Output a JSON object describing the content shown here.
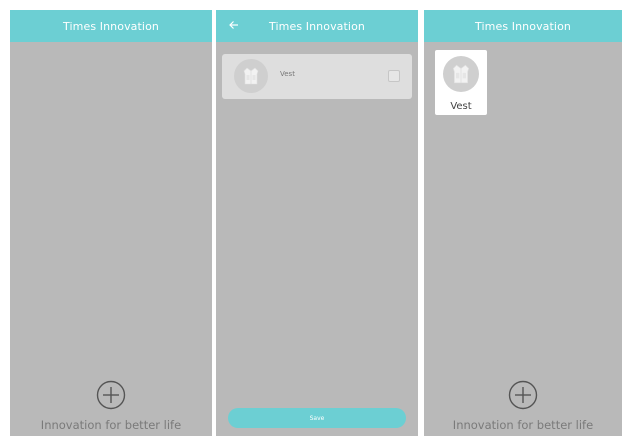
{
  "colors": {
    "header": "#6ccfd3",
    "background": "#b9b9b9",
    "card": "#dedede",
    "tile": "#ffffff",
    "slogan_text": "#7a7a7a"
  },
  "screen_home_empty": {
    "title": "Times Innovation",
    "add_icon": "plus-circle-icon",
    "slogan": "Innovation for better life"
  },
  "screen_select_device": {
    "title": "Times Innovation",
    "back_icon": "arrow-left-icon",
    "device": {
      "name": "Vest",
      "icon": "vest-icon",
      "checked": false
    },
    "save_label": "Save"
  },
  "screen_home_device": {
    "title": "Times Innovation",
    "device": {
      "name": "Vest",
      "icon": "vest-icon"
    },
    "add_icon": "plus-circle-icon",
    "slogan": "Innovation for better life"
  }
}
